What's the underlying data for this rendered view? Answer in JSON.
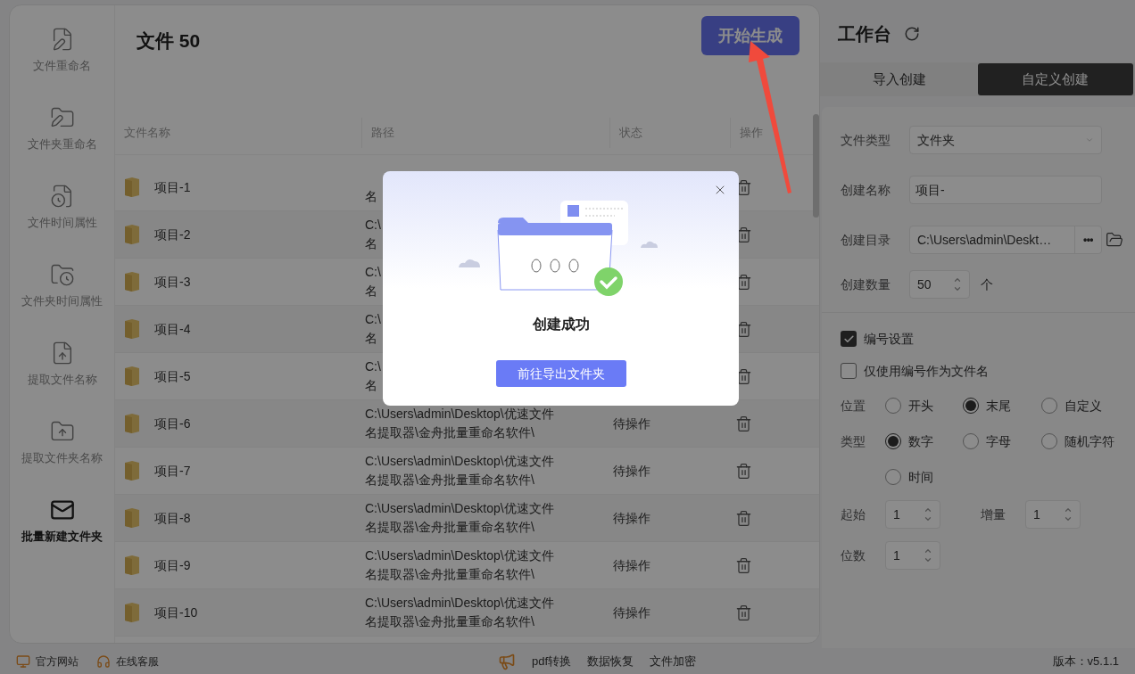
{
  "sidebar": {
    "items": [
      {
        "label": "文件重命名",
        "selected": false
      },
      {
        "label": "文件夹重命名",
        "selected": false
      },
      {
        "label": "文件时间属性",
        "selected": false
      },
      {
        "label": "文件夹时间属性",
        "selected": false
      },
      {
        "label": "提取文件名称",
        "selected": false
      },
      {
        "label": "提取文件夹名称",
        "selected": false
      },
      {
        "label": "批量新建文件夹",
        "selected": true
      }
    ]
  },
  "main": {
    "title": "文件 50",
    "start_button": "开始生成"
  },
  "table": {
    "columns": [
      "文件名称",
      "路径",
      "状态",
      "操作"
    ],
    "rows": [
      {
        "name": "项目-1",
        "path": [
          "名"
        ]
      },
      {
        "name": "项目-2",
        "path": [
          "C:\\",
          "名"
        ]
      },
      {
        "name": "项目-3",
        "path": [
          "C:\\",
          "名"
        ]
      },
      {
        "name": "项目-4",
        "path": [
          "C:\\",
          "名"
        ]
      },
      {
        "name": "项目-5",
        "path": [
          "C:\\",
          "名"
        ]
      },
      {
        "name": "项目-6",
        "path": [
          "C:\\Users\\admin\\Desktop\\优速文件",
          "名提取器\\金舟批量重命名软件\\"
        ],
        "status": "待操作"
      },
      {
        "name": "项目-7",
        "path": [
          "C:\\Users\\admin\\Desktop\\优速文件",
          "名提取器\\金舟批量重命名软件\\"
        ],
        "status": "待操作"
      },
      {
        "name": "项目-8",
        "path": [
          "C:\\Users\\admin\\Desktop\\优速文件",
          "名提取器\\金舟批量重命名软件\\"
        ],
        "status": "待操作"
      },
      {
        "name": "项目-9",
        "path": [
          "C:\\Users\\admin\\Desktop\\优速文件",
          "名提取器\\金舟批量重命名软件\\"
        ],
        "status": "待操作"
      },
      {
        "name": "项目-10",
        "path": [
          "C:\\Users\\admin\\Desktop\\优速文件",
          "名提取器\\金舟批量重命名软件\\"
        ],
        "status": "待操作"
      }
    ]
  },
  "workbench": {
    "title": "工作台",
    "tabs": [
      {
        "label": "导入创建",
        "selected": false
      },
      {
        "label": "自定义创建",
        "selected": true
      }
    ],
    "file_type": {
      "label": "文件类型",
      "value": "文件夹"
    },
    "name": {
      "label": "创建名称",
      "value": "项目-"
    },
    "directory": {
      "label": "创建目录",
      "value": "C:\\Users\\admin\\Deskt…",
      "browse": "•••"
    },
    "count": {
      "label": "创建数量",
      "value": "50",
      "unit": "个"
    },
    "checkboxes": [
      {
        "label": "编号设置",
        "checked": true
      },
      {
        "label": "仅使用编号作为文件名",
        "checked": false
      }
    ],
    "radio_groups": [
      {
        "label": "位置",
        "options": [
          {
            "label": "开头",
            "selected": false
          },
          {
            "label": "末尾",
            "selected": true
          },
          {
            "label": "自定义",
            "selected": false
          }
        ]
      },
      {
        "label": "类型",
        "options": [
          {
            "label": "数字",
            "selected": true
          },
          {
            "label": "字母",
            "selected": false
          },
          {
            "label": "随机字符",
            "selected": false
          },
          {
            "label": "时间",
            "selected": false
          }
        ]
      }
    ],
    "numbers": [
      {
        "label": "起始",
        "value": "1"
      },
      {
        "label": "增量",
        "value": "1"
      },
      {
        "label": "位数",
        "value": "1"
      }
    ]
  },
  "dialog": {
    "title": "创建成功",
    "button": "前往导出文件夹"
  },
  "footer": {
    "left": [
      "官方网站",
      "在线客服"
    ],
    "center": [
      "pdf转换",
      "数据恢复",
      "文件加密"
    ],
    "version": "版本：v5.1.1"
  }
}
